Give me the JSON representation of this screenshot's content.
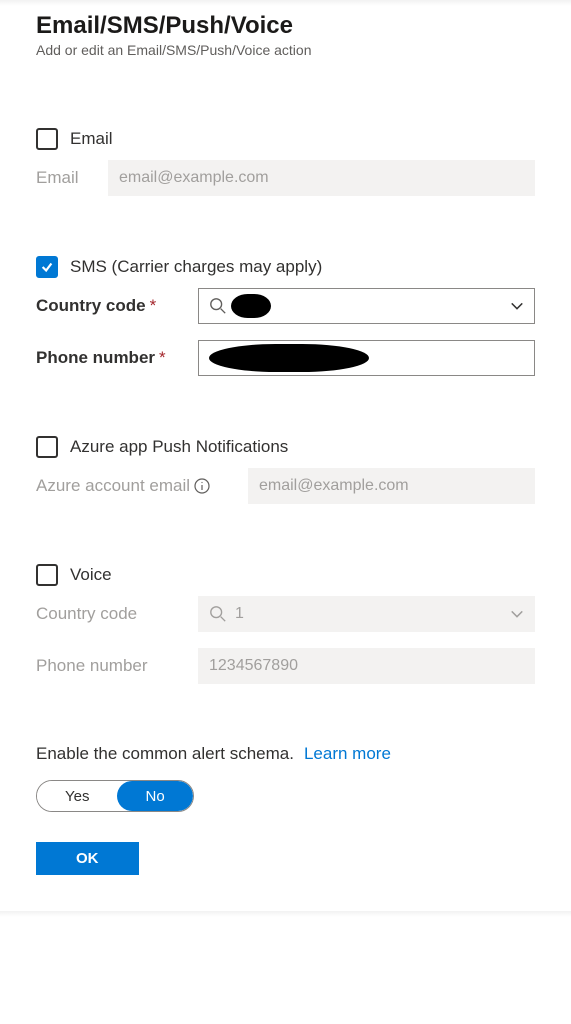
{
  "header": {
    "title": "Email/SMS/Push/Voice",
    "subtitle": "Add or edit an Email/SMS/Push/Voice action"
  },
  "email": {
    "checkbox_label": "Email",
    "checked": false,
    "field_label": "Email",
    "placeholder": "email@example.com"
  },
  "sms": {
    "checkbox_label": "SMS (Carrier charges may apply)",
    "checked": true,
    "country_code_label": "Country code",
    "country_code_required": "*",
    "country_code_value": "",
    "phone_label": "Phone number",
    "phone_required": "*",
    "phone_value": ""
  },
  "push": {
    "checkbox_label": "Azure app Push Notifications",
    "checked": false,
    "field_label": "Azure account email",
    "placeholder": "email@example.com"
  },
  "voice": {
    "checkbox_label": "Voice",
    "checked": false,
    "country_code_label": "Country code",
    "country_code_value": "1",
    "phone_label": "Phone number",
    "phone_placeholder": "1234567890"
  },
  "schema": {
    "text": "Enable the common alert schema.",
    "link": "Learn more",
    "option_yes": "Yes",
    "option_no": "No",
    "selected": "No"
  },
  "footer": {
    "ok": "OK"
  }
}
